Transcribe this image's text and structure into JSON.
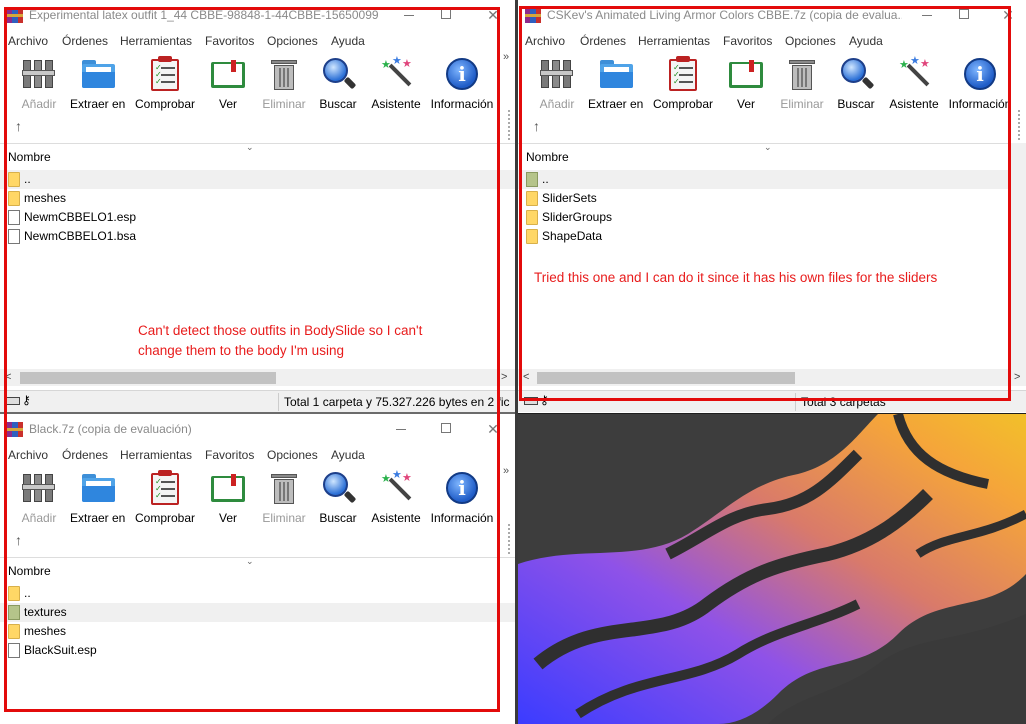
{
  "menu": [
    "Archivo",
    "Órdenes",
    "Herramientas",
    "Favoritos",
    "Opciones",
    "Ayuda"
  ],
  "toolbar": {
    "add": "Añadir",
    "extract": "Extraer en",
    "check": "Comprobar",
    "view": "Ver",
    "delete": "Eliminar",
    "search": "Buscar",
    "wizard": "Asistente",
    "info": "Información"
  },
  "column_name": "Nombre",
  "colors": {
    "annotation": "#e81c1c",
    "folder": "#ffd766",
    "selection": "#f0f0f0"
  },
  "windows": [
    {
      "title": "Experimental latex outfit 1_44 CBBE-98848-1-44CBBE-156500990...",
      "files": [
        {
          "name": "..",
          "icon": "folder-icon"
        },
        {
          "name": "meshes",
          "icon": "folder-icon"
        },
        {
          "name": "NewmCBBELO1.esp",
          "icon": "file-icon"
        },
        {
          "name": "NewmCBBELO1.bsa",
          "icon": "file-icon"
        }
      ],
      "annotation": [
        "Can't detect those outfits in BodySlide so I can't",
        "change them to the body I'm using"
      ],
      "status": "Total 1 carpeta y 75.327.226 bytes en 2 fic"
    },
    {
      "title": "CSKev's Animated Living Armor Colors CBBE.7z (copia de evalua...",
      "files": [
        {
          "name": "..",
          "icon": "folder-icon"
        },
        {
          "name": "SliderSets",
          "icon": "folder-icon"
        },
        {
          "name": "SliderGroups",
          "icon": "folder-icon"
        },
        {
          "name": "ShapeData",
          "icon": "folder-icon"
        }
      ],
      "annotation": [
        "Tried this one and I can do it since it has his own files for the sliders"
      ],
      "status": "Total 3 carpetas"
    },
    {
      "title": "Black.7z (copia de evaluación)",
      "files": [
        {
          "name": "..",
          "icon": "folder-icon"
        },
        {
          "name": "textures",
          "icon": "folder-icon"
        },
        {
          "name": "meshes",
          "icon": "folder-icon"
        },
        {
          "name": "BlackSuit.esp",
          "icon": "file-icon"
        }
      ]
    }
  ]
}
